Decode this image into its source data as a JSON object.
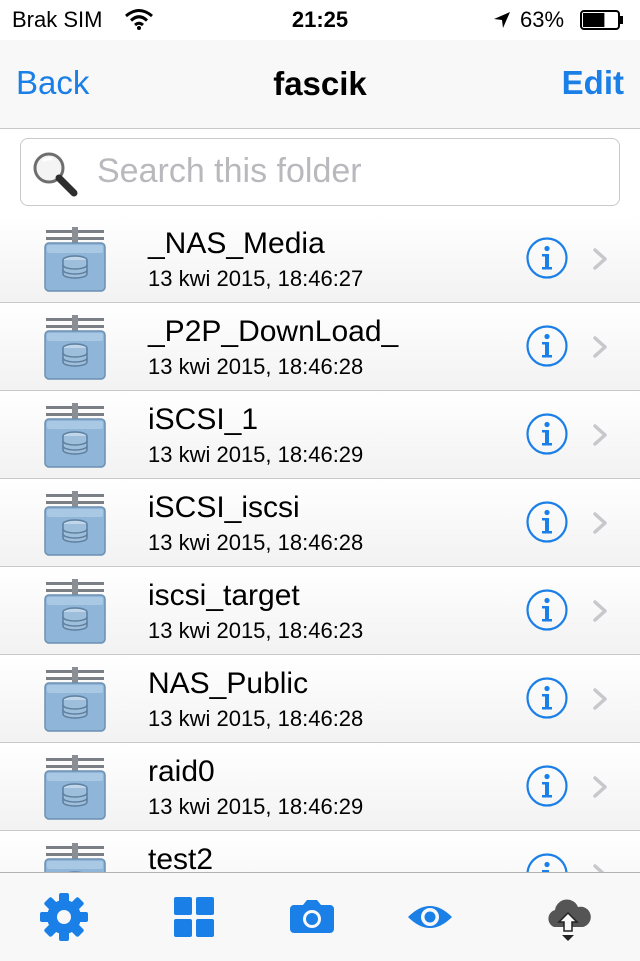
{
  "status": {
    "carrier": "Brak SIM",
    "time": "21:25",
    "battery": "63%",
    "battery_level": 0.63,
    "icons": [
      "wifi-icon",
      "location-arrow-icon",
      "battery-icon"
    ]
  },
  "nav": {
    "back_label": "Back",
    "title": "fascik",
    "edit_label": "Edit"
  },
  "search": {
    "placeholder": "Search this folder",
    "value": ""
  },
  "items": [
    {
      "name": "_NAS_Media",
      "date": "13 kwi 2015, 18:46:27"
    },
    {
      "name": "_P2P_DownLoad_",
      "date": "13 kwi 2015, 18:46:28"
    },
    {
      "name": "iSCSI_1",
      "date": "13 kwi 2015, 18:46:29"
    },
    {
      "name": "iSCSI_iscsi",
      "date": "13 kwi 2015, 18:46:28"
    },
    {
      "name": "iscsi_target",
      "date": "13 kwi 2015, 18:46:23"
    },
    {
      "name": "NAS_Public",
      "date": "13 kwi 2015, 18:46:28"
    },
    {
      "name": "raid0",
      "date": "13 kwi 2015, 18:46:29"
    },
    {
      "name": "test2",
      "date": ""
    }
  ],
  "tabs": [
    {
      "icon": "gear-icon"
    },
    {
      "icon": "grid-icon"
    },
    {
      "icon": "camera-icon"
    },
    {
      "icon": "eye-icon"
    },
    {
      "icon": "cloud-download-icon"
    }
  ],
  "colors": {
    "accent": "#1a7fe6",
    "folder": "#8fb6d8",
    "separator": "#c8c7cc",
    "chevron": "#c7c7cc"
  }
}
